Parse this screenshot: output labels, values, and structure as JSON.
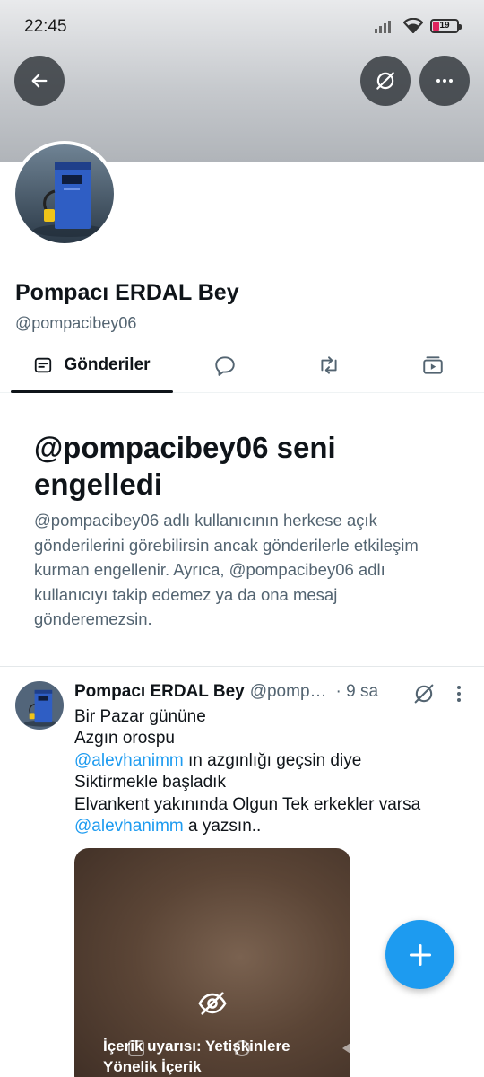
{
  "status_bar": {
    "time": "22:45",
    "battery_level": "19",
    "icons": [
      "signal-icon",
      "wifi-icon",
      "battery-icon"
    ]
  },
  "header": {
    "back_icon": "arrow-left-icon",
    "mute_icon": "mute-icon",
    "more_icon": "more-horizontal-icon"
  },
  "profile": {
    "display_name": "Pompacı ERDAL Bey",
    "handle": "@pompacibey06"
  },
  "tabs": [
    {
      "label": "Gönderiler",
      "icon": "posts-icon",
      "active": true
    },
    {
      "label": "",
      "icon": "reply-icon",
      "active": false
    },
    {
      "label": "",
      "icon": "repost-icon",
      "active": false
    },
    {
      "label": "",
      "icon": "media-icon",
      "active": false
    }
  ],
  "blocked_notice": {
    "title": "@pompacibey06 seni engelledi",
    "description": "@pompacibey06 adlı kullanıcının herkese açık gönderilerini görebilirsin ancak gönderilerle etkileşim kurman engellenir. Ayrıca, @pompacibey06 adlı kullanıcıyı takip edemez ya da ona mesaj gönderemezsin."
  },
  "tweet": {
    "author_name": "Pompacı ERDAL Bey",
    "author_handle": "@pomp…",
    "time": "· 9 sa",
    "lines": {
      "line1": "Bir Pazar gününe",
      "line2": "Azgın orospu",
      "line3_mention": "@alevhanimm",
      "line3_rest": " ın azgınlığı geçsin diye",
      "line4": "Siktirmekle başladık",
      "line5": "Elvankent yakınında Olgun Tek erkekler varsa",
      "line6_mention": "@alevhanimm",
      "line6_rest": " a yazsın.."
    },
    "media_warning": "İçerik uyarısı: Yetişkinlere Yönelik İçerik"
  },
  "fab": {
    "icon": "plus-icon"
  },
  "colors": {
    "accent": "#1d9bf0",
    "text_primary": "#0f1419",
    "text_secondary": "#536471"
  }
}
